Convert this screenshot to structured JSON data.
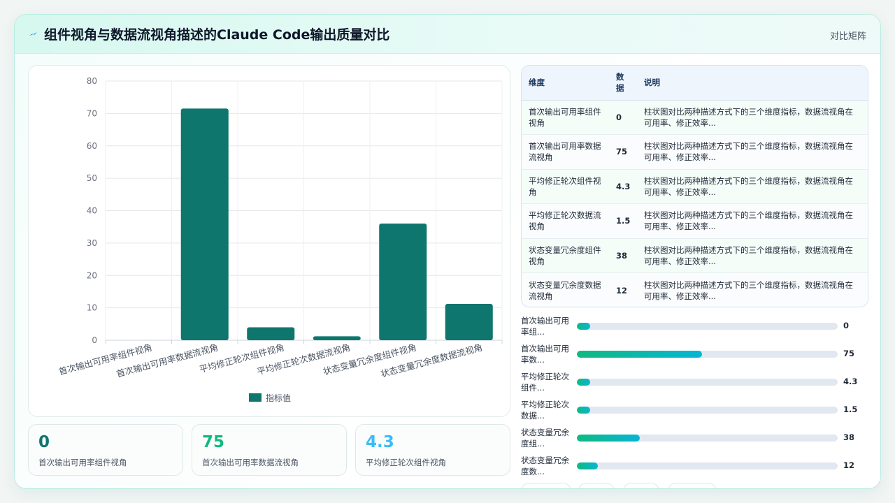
{
  "header": {
    "title": "组件视角与数据流视角描述的Claude Code输出质量对比",
    "right_label": "对比矩阵"
  },
  "chart_data": {
    "type": "bar",
    "categories": [
      "首次输出可用率组件视角",
      "首次输出可用率数据流视角",
      "平均修正轮次组件视角",
      "平均修正轮次数据流视角",
      "状态变量冗余度组件视角",
      "状态变量冗余度数据流视角"
    ],
    "series": [
      {
        "name": "指标值",
        "values": [
          0,
          71.5,
          4,
          1.2,
          36,
          11.2
        ]
      }
    ],
    "ylim": [
      0,
      80
    ],
    "yticks": [
      0,
      10,
      20,
      30,
      40,
      50,
      60,
      70,
      80
    ],
    "grid": true,
    "legend": "bottom",
    "bar_color": "#0f766e"
  },
  "stats": [
    {
      "value": "0",
      "label": "首次输出可用率组件视角",
      "color": "#0f766e"
    },
    {
      "value": "75",
      "label": "首次输出可用率数据流视角",
      "color": "#10b981"
    },
    {
      "value": "4.3",
      "label": "平均修正轮次组件视角",
      "color": "#38bdf8"
    }
  ],
  "table": {
    "headers": [
      "维度",
      "数据",
      "说明"
    ],
    "rows": [
      {
        "dim": "首次输出可用率组件视角",
        "val": "0",
        "desc": "柱状图对比两种描述方式下的三个维度指标，数据流视角在可用率、修正效率..."
      },
      {
        "dim": "首次输出可用率数据流视角",
        "val": "75",
        "desc": "柱状图对比两种描述方式下的三个维度指标，数据流视角在可用率、修正效率..."
      },
      {
        "dim": "平均修正轮次组件视角",
        "val": "4.3",
        "desc": "柱状图对比两种描述方式下的三个维度指标，数据流视角在可用率、修正效率..."
      },
      {
        "dim": "平均修正轮次数据流视角",
        "val": "1.5",
        "desc": "柱状图对比两种描述方式下的三个维度指标，数据流视角在可用率、修正效率..."
      },
      {
        "dim": "状态变量冗余度组件视角",
        "val": "38",
        "desc": "柱状图对比两种描述方式下的三个维度指标，数据流视角在可用率、修正效率..."
      },
      {
        "dim": "状态变量冗余度数据流视角",
        "val": "12",
        "desc": "柱状图对比两种描述方式下的三个维度指标，数据流视角在可用率、修正效率..."
      }
    ]
  },
  "progress_bars": [
    {
      "label": "首次输出可用率组...",
      "value": "0",
      "percent": 5
    },
    {
      "label": "首次输出可用率数...",
      "value": "75",
      "percent": 48
    },
    {
      "label": "平均修正轮次组件...",
      "value": "4.3",
      "percent": 5
    },
    {
      "label": "平均修正轮次数据...",
      "value": "1.5",
      "percent": 5
    },
    {
      "label": "状态变量冗余度组...",
      "value": "38",
      "percent": 24
    },
    {
      "label": "状态变量冗余度数...",
      "value": "12",
      "percent": 8
    }
  ],
  "colors": {
    "accent": "#0f766e",
    "header_bg": "#d6f8ef",
    "grad_start": "#10b981",
    "grad_end": "#06b6d4"
  }
}
